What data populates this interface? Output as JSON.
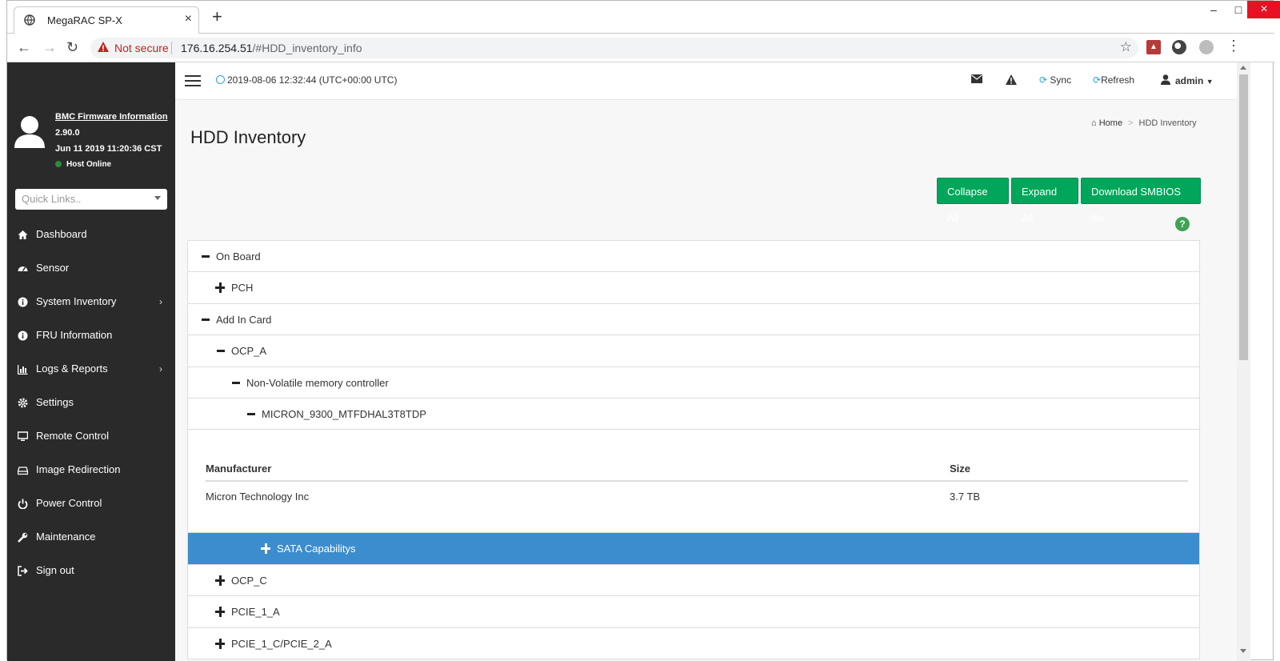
{
  "browser": {
    "tab_title": "MegaRAC SP-X",
    "new_tab": "+",
    "close_tab": "×",
    "security_label": "Not secure",
    "url_host": "176.16.254.51",
    "url_path": "/#HDD_inventory_info",
    "min_label": "–",
    "max_label": "□",
    "close_label": "×"
  },
  "sidebar": {
    "fw_link": "BMC Firmware Information",
    "fw_version": "2.90.0",
    "fw_date": "Jun 11 2019 11:20:36 CST",
    "host_status": "Host Online",
    "quick_links_placeholder": "Quick Links..",
    "items": [
      {
        "label": "Dashboard",
        "icon": "home-icon"
      },
      {
        "label": "Sensor",
        "icon": "dashboard-gauge-icon"
      },
      {
        "label": "System Inventory",
        "icon": "info-icon",
        "has_submenu": true
      },
      {
        "label": "FRU Information",
        "icon": "info-icon"
      },
      {
        "label": "Logs & Reports",
        "icon": "bar-chart-icon",
        "has_submenu": true
      },
      {
        "label": "Settings",
        "icon": "gear-icon"
      },
      {
        "label": "Remote Control",
        "icon": "monitor-icon"
      },
      {
        "label": "Image Redirection",
        "icon": "drive-icon"
      },
      {
        "label": "Power Control",
        "icon": "power-icon"
      },
      {
        "label": "Maintenance",
        "icon": "wrench-icon"
      },
      {
        "label": "Sign out",
        "icon": "sign-out-icon"
      }
    ]
  },
  "topbar": {
    "datetime": "2019-08-06 12:32:44 (UTC+00:00 UTC)",
    "sync": "Sync",
    "refresh": "Refresh",
    "user": "admin"
  },
  "page": {
    "title": "HDD Inventory",
    "breadcrumb_home": "Home",
    "breadcrumb_current": "HDD Inventory",
    "collapse_all": "Collapse All",
    "expand_all": "Expand All",
    "download": "Download SMBIOS file",
    "help": "?"
  },
  "tree": {
    "on_board": "On Board",
    "pch": "PCH",
    "add_in_card": "Add In Card",
    "ocp_a": "OCP_A",
    "nvm_controller": "Non-Volatile memory controller",
    "drive": "MICRON_9300_MTFDHAL3T8TDP",
    "sata": "SATA Capabilitys",
    "ocp_c": "OCP_C",
    "pcie_1_a": "PCIE_1_A",
    "pcie_next": "PCIE_1_C/PCIE_2_A"
  },
  "detail": {
    "headers": [
      "Manufacturer",
      "Size"
    ],
    "rows": [
      [
        "Micron Technology Inc",
        "3.7 TB"
      ]
    ]
  },
  "colors": {
    "sidebar_bg": "#2a2a2a",
    "button_green": "#00a65a",
    "selected_row": "#3c8dcd",
    "accent": "#29a3d6"
  }
}
